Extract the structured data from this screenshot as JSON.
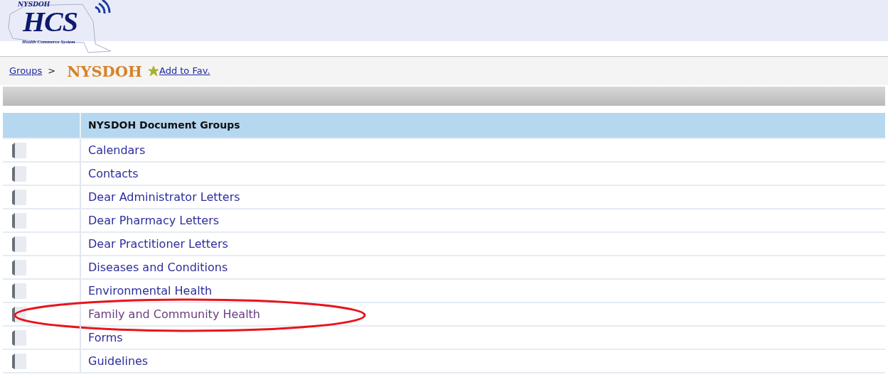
{
  "logo": {
    "agency": "NYSDOH",
    "name": "HCS",
    "tagline": "Health Commerce System"
  },
  "breadcrumb": {
    "link": "Groups",
    "separator": ">",
    "current": "NYSDOH",
    "favorite": "Add to Fav."
  },
  "table": {
    "columns": [
      "NYSDOH Document Groups"
    ],
    "rows": [
      {
        "label": "Calendars",
        "visited": false,
        "circled": false
      },
      {
        "label": "Contacts",
        "visited": false,
        "circled": false
      },
      {
        "label": "Dear Administrator Letters",
        "visited": false,
        "circled": false
      },
      {
        "label": "Dear Pharmacy Letters",
        "visited": false,
        "circled": false
      },
      {
        "label": "Dear Practitioner Letters",
        "visited": false,
        "circled": false
      },
      {
        "label": "Diseases and Conditions",
        "visited": false,
        "circled": false
      },
      {
        "label": "Environmental Health",
        "visited": false,
        "circled": false
      },
      {
        "label": "Family and Community Health",
        "visited": true,
        "circled": true
      },
      {
        "label": "Forms",
        "visited": false,
        "circled": false
      },
      {
        "label": "Guidelines",
        "visited": false,
        "circled": false
      }
    ]
  }
}
